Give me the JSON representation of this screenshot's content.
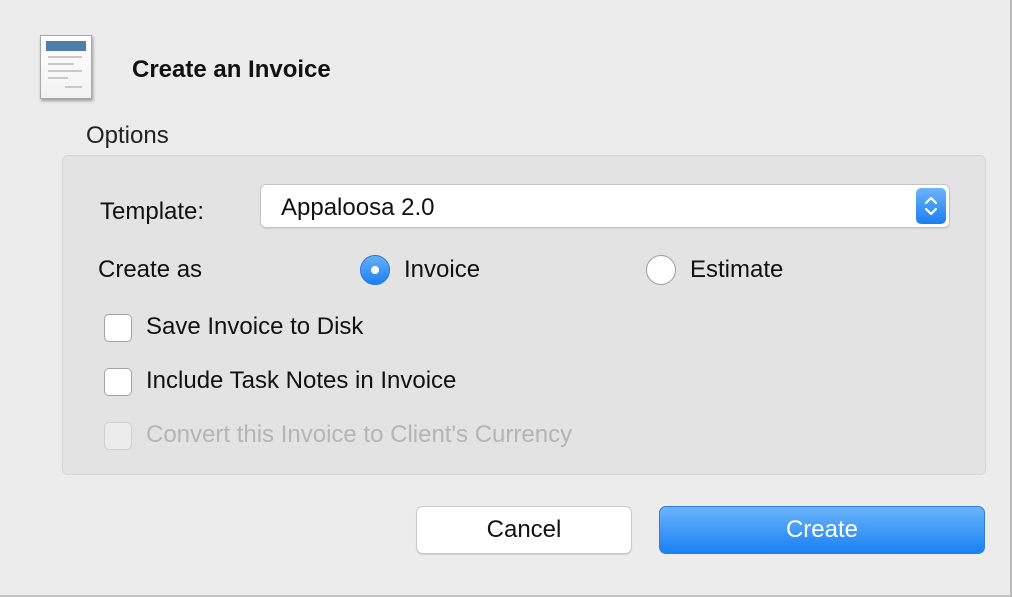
{
  "dialog": {
    "title": "Create an Invoice",
    "icon": "invoice-document-icon"
  },
  "options": {
    "section_label": "Options",
    "template_label": "Template:",
    "template_value": "Appaloosa 2.0",
    "create_as_label": "Create as",
    "create_as_options": [
      {
        "label": "Invoice",
        "selected": true
      },
      {
        "label": "Estimate",
        "selected": false
      }
    ],
    "checkboxes": [
      {
        "label": "Save Invoice to Disk",
        "checked": false,
        "enabled": true
      },
      {
        "label": "Include Task Notes in Invoice",
        "checked": false,
        "enabled": true
      },
      {
        "label": "Convert this Invoice to Client's Currency",
        "checked": false,
        "enabled": false
      }
    ]
  },
  "buttons": {
    "cancel_label": "Cancel",
    "create_label": "Create"
  },
  "colors": {
    "accent": "#1a80f3",
    "panel": "#e3e3e3",
    "window": "#ececec",
    "disabled_text": "#b5b5b5"
  }
}
